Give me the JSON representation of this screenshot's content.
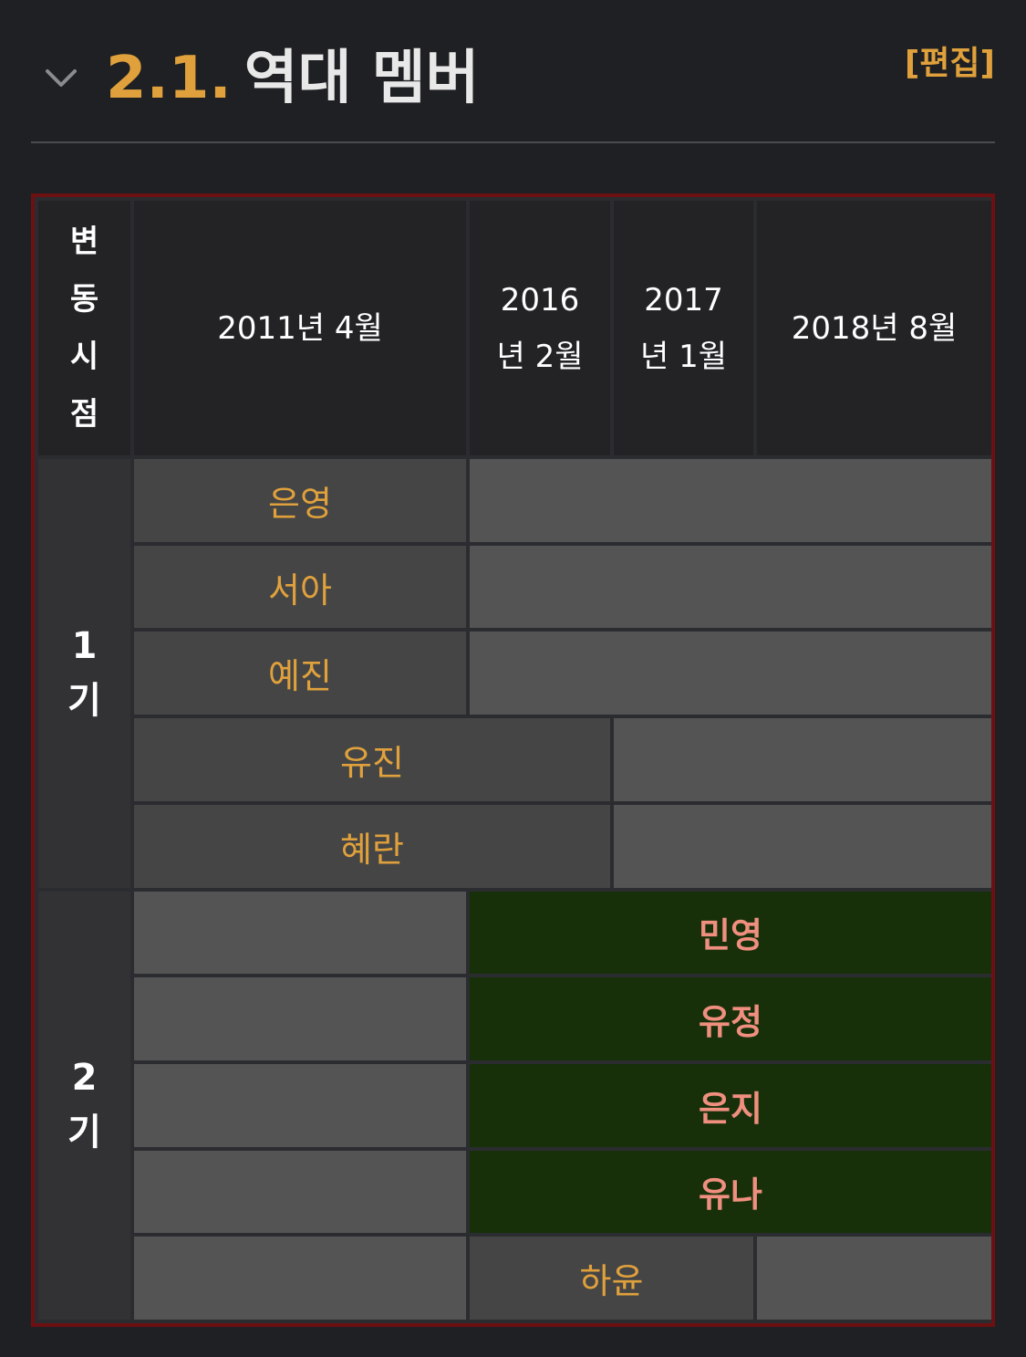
{
  "heading": {
    "number": "2.1.",
    "title": "역대 멤버",
    "edit_label": "[편집]"
  },
  "table": {
    "header": {
      "label_lines": [
        "변",
        "동",
        "시",
        "점"
      ],
      "col1": "2011년 4월",
      "col2_lines": [
        "2016",
        "년 2월"
      ],
      "col3_lines": [
        "2017",
        "년 1월"
      ],
      "col4": "2018년 8월"
    },
    "gen1": {
      "label_lines": [
        "1",
        "기"
      ],
      "members": [
        "은영",
        "서아",
        "예진",
        "유진",
        "혜란"
      ]
    },
    "gen2": {
      "label_lines": [
        "2",
        "기"
      ],
      "members": [
        "민영",
        "유정",
        "은지",
        "유나",
        "하윤"
      ]
    }
  },
  "colors": {
    "background": "#1f2023",
    "accent": "#e0a13c",
    "table_border": "#6d1012",
    "active_fill": "#17300a",
    "active_text": "#f08f7f"
  }
}
